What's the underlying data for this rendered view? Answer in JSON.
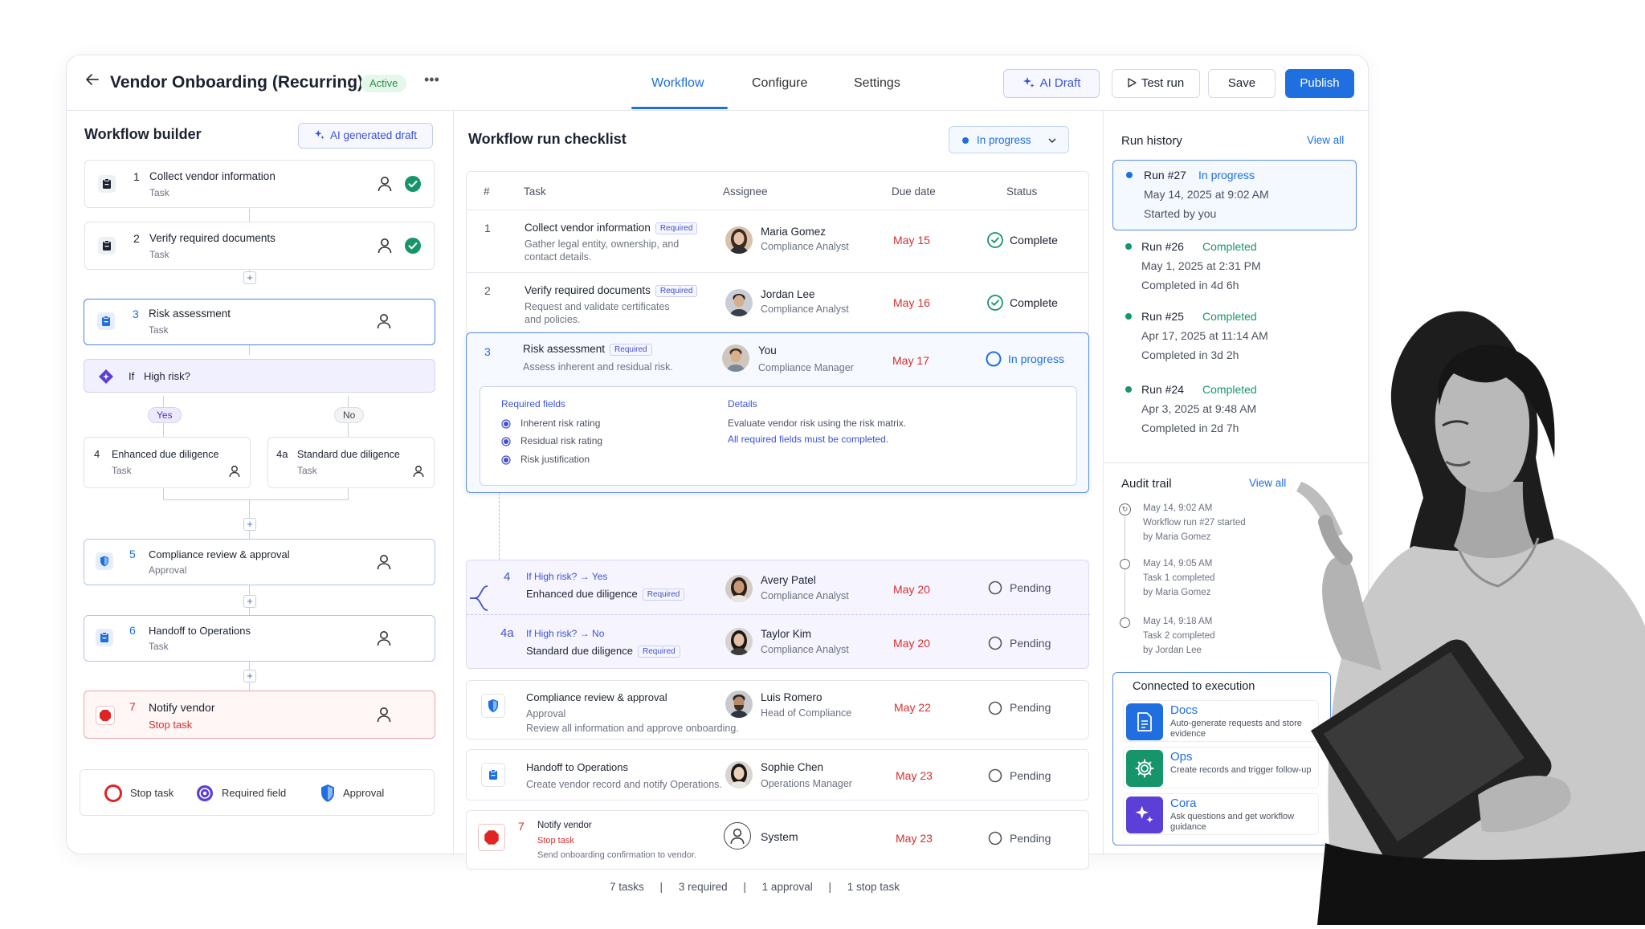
{
  "header": {
    "back_icon": "arrow-left-icon",
    "title": "Vendor Onboarding (Recurring)",
    "status_badge": "Active",
    "more_icon": "more-horizontal-icon",
    "tabs": [
      {
        "label": "Workflow",
        "active": true
      },
      {
        "label": "Configure",
        "active": false
      },
      {
        "label": "Settings",
        "active": false
      }
    ],
    "buttons": {
      "ai_draft": "AI Draft",
      "test_run": "Test run",
      "save": "Save",
      "publish": "Publish"
    }
  },
  "builder": {
    "title": "Workflow builder",
    "ai_button": "AI generated draft",
    "nodes": [
      {
        "num": "1",
        "label": "Collect vendor information",
        "sub": "Task",
        "done": true
      },
      {
        "num": "2",
        "label": "Verify required documents",
        "sub": "Task",
        "done": true
      },
      {
        "num": "3",
        "label": "Risk assessment",
        "sub": "Task",
        "selected": true
      },
      {
        "num": "4",
        "label": "Enhanced due diligence",
        "sub": "Task"
      },
      {
        "num": "4a",
        "label": "Standard due diligence",
        "sub": "Task"
      },
      {
        "num": "5",
        "label": "Compliance review & approval",
        "sub": "Approval"
      },
      {
        "num": "6",
        "label": "Handoff to Operations",
        "sub": "Task"
      },
      {
        "num": "7",
        "label": "Notify vendor",
        "sub": "Stop task"
      }
    ],
    "condition": {
      "prefix": "If",
      "label": "High risk?",
      "yes": "Yes",
      "no": "No"
    },
    "legend": {
      "stop": "Stop task",
      "required": "Required field",
      "approval": "Approval"
    }
  },
  "checklist": {
    "title": "Workflow run checklist",
    "status_select": "In progress",
    "columns": {
      "num": "#",
      "task": "Task",
      "assignee": "Assignee",
      "due": "Due date",
      "status": "Status"
    },
    "required_tag": "Required",
    "rows": [
      {
        "num": "1",
        "task": "Collect vendor information",
        "desc": "Gather legal entity, ownership, and contact details.",
        "assignee": "Maria Gomez",
        "role": "Compliance Analyst",
        "due": "May 15",
        "status": "Complete"
      },
      {
        "num": "2",
        "task": "Verify required documents",
        "desc": "Request and validate certificates and policies.",
        "assignee": "Jordan Lee",
        "role": "Compliance Analyst",
        "due": "May 16",
        "status": "Complete"
      },
      {
        "num": "3",
        "task": "Risk assessment",
        "desc": "Assess inherent and residual risk.",
        "assignee": "You",
        "role": "Compliance Manager",
        "due": "May 17",
        "status": "In progress"
      },
      {
        "num": "4",
        "cond": "If High risk?",
        "branch": "Yes",
        "task": "Enhanced due diligence",
        "assignee": "Avery Patel",
        "role": "Compliance Analyst",
        "due": "May 20",
        "status": "Pending"
      },
      {
        "num": "4a",
        "cond": "If High risk?",
        "branch": "No",
        "task": "Standard due diligence",
        "assignee": "Taylor Kim",
        "role": "Compliance Analyst",
        "due": "May 20",
        "status": "Pending"
      },
      {
        "num": "",
        "task": "Compliance review & approval",
        "type": "Approval",
        "desc": "Review all information and approve onboarding.",
        "assignee": "Luis Romero",
        "role": "Head of Compliance",
        "due": "May 22",
        "status": "Pending"
      },
      {
        "num": "",
        "task": "Handoff to Operations",
        "desc": "Create vendor record and notify Operations.",
        "assignee": "Sophie Chen",
        "role": "Operations Manager",
        "due": "May 23",
        "status": "Pending"
      },
      {
        "num": "7",
        "task": "Notify vendor",
        "type": "Stop task",
        "desc": "Send onboarding confirmation to vendor.",
        "assignee": "System",
        "role": "",
        "due": "May 23",
        "status": "Pending"
      }
    ],
    "expanded": {
      "required_title": "Required fields",
      "required_fields": [
        "Inherent risk rating",
        "Residual risk rating",
        "Risk justification"
      ],
      "details_title": "Details",
      "details_text": "Evaluate vendor risk using the risk matrix.",
      "details_note": "All required fields must be completed."
    },
    "footer": {
      "tasks": "7 tasks",
      "required": "3 required",
      "approval": "1 approval",
      "stop": "1 stop task",
      "sep": "|"
    }
  },
  "run_history": {
    "title": "Run history",
    "view_all": "View all",
    "runs": [
      {
        "run": "Run #27",
        "status": "In progress",
        "date": "May 14, 2025 at 9:02 AM",
        "note": "Started by you"
      },
      {
        "run": "Run #26",
        "status": "Completed",
        "date": "May 1, 2025 at 2:31 PM",
        "note": "Completed in 4d 6h"
      },
      {
        "run": "Run #25",
        "status": "Completed",
        "date": "Apr 17, 2025 at 11:14 AM",
        "note": "Completed in 3d 2h"
      },
      {
        "run": "Run #24",
        "status": "Completed",
        "date": "Apr 3, 2025 at 9:48 AM",
        "note": "Completed in 2d 7h"
      }
    ]
  },
  "audit": {
    "title": "Audit trail",
    "view_all": "View all",
    "entries": [
      {
        "time": "May 14, 9:02 AM",
        "event": "Workflow run #27 started",
        "by": "by Maria Gomez"
      },
      {
        "time": "May 14, 9:05 AM",
        "event": "Task 1 completed",
        "by": "by Maria Gomez"
      },
      {
        "time": "May 14, 9:18 AM",
        "event": "Task 2 completed",
        "by": "by Jordan Lee"
      }
    ]
  },
  "execution": {
    "title": "Connected to execution",
    "items": [
      {
        "name": "Docs",
        "desc": "Auto-generate requests and store evidence",
        "icon": "document-icon",
        "color": "#1f6fe0"
      },
      {
        "name": "Ops",
        "desc": "Create records and trigger follow-up",
        "icon": "gear-icon",
        "color": "#17956a"
      },
      {
        "name": "Cora",
        "desc": "Ask questions and get workflow guidance",
        "icon": "sparkle-icon",
        "color": "#5b3fd6"
      }
    ]
  },
  "colors": {
    "accent": "#1f6fe0",
    "success": "#17956a",
    "danger": "#d62f2f",
    "purple": "#4250c9"
  }
}
